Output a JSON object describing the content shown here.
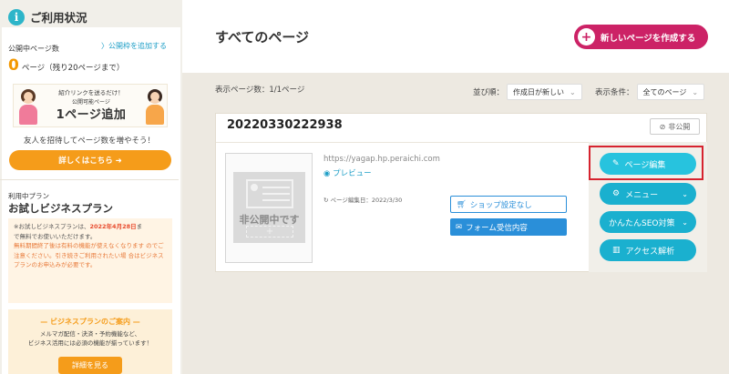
{
  "sidebar": {
    "title": "ご利用状況",
    "published_label": "公開中ページ数",
    "add_link": "〉公開枠を追加する",
    "count": "0",
    "count_text": "ページ（残り20ページまで）",
    "promo": {
      "line1": "紹介リンクを送るだけ！",
      "line2": "公開可能ページ",
      "line3": "1ページ追加"
    },
    "invite_text": "友人を招待してページ数を増やそう！",
    "details_button": "詳しくはこちら ➜",
    "plan_label": "利用中プラン",
    "plan_name": "お試しビジネスプラン",
    "notice": {
      "line1_a": "※お試しビジネスプランは、",
      "line1_date": "2022年4月28日",
      "line1_b": "ま",
      "line2": "で無料でお使いいただけます。",
      "warn": "無料期間終了後は有料の機能が使えなくなります のでご注意ください。引き続きご利用されたい場 合はビジネスプランのお申込みが必要です。"
    },
    "guide": {
      "title": "— ビジネスプランのご案内 —",
      "text1": "メルマガ配信・決済・予約機能など、",
      "text2": "ビジネス活用には必須の機能が揃っています！",
      "button": "詳細を見る"
    }
  },
  "main": {
    "title": "すべてのページ",
    "create_button": "新しいページを作成する",
    "display_count": "表示ページ数：1/1ページ",
    "sort_label": "並び順：",
    "sort_value": "作成日が新しい",
    "filter_label": "表示条件：",
    "filter_value": "全てのページ"
  },
  "page_card": {
    "title": "20220330222938",
    "status": "非公開",
    "thumb_text": "非公開中です",
    "url": "https://yagap.hp.peraichi.com",
    "preview": "プレビュー",
    "edit_date": "ページ編集日：2022/3/30",
    "shop_button": "ショップ設定なし",
    "form_button": "フォーム受信内容",
    "actions": {
      "edit": "ページ編集",
      "menu": "メニュー",
      "seo": "かんたんSEO対策",
      "analytics": "アクセス解析"
    }
  },
  "colors": {
    "accent_cyan": "#27c3de",
    "create_magenta": "#cc2266",
    "orange": "#f59c1a",
    "blue": "#2a8fd9",
    "highlight_red": "#d6232f"
  }
}
